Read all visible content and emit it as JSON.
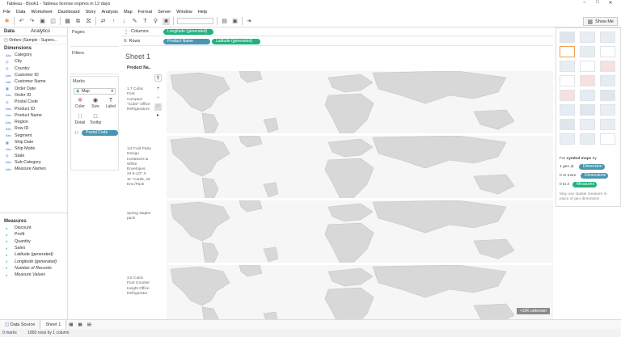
{
  "window": {
    "title": "Tableau - Book1 - Tableau license expires in 12 days"
  },
  "menu": [
    "File",
    "Data",
    "Worksheet",
    "Dashboard",
    "Story",
    "Analysis",
    "Map",
    "Format",
    "Server",
    "Window",
    "Help"
  ],
  "toolbar": {
    "show_me_label": "Show Me"
  },
  "left": {
    "tabs": [
      "Data",
      "Analytics"
    ],
    "datasource": "Orders (Sample - Supers...",
    "dimensions_header": "Dimensions",
    "dimensions": [
      {
        "name": "Category",
        "type": "Abc"
      },
      {
        "name": "City",
        "type": "geo"
      },
      {
        "name": "Country",
        "type": "geo"
      },
      {
        "name": "Customer ID",
        "type": "Abc"
      },
      {
        "name": "Customer Name",
        "type": "Abc"
      },
      {
        "name": "Order Date",
        "type": "date"
      },
      {
        "name": "Order ID",
        "type": "Abc"
      },
      {
        "name": "Postal Code",
        "type": "geo"
      },
      {
        "name": "Product ID",
        "type": "Abc"
      },
      {
        "name": "Product Name",
        "type": "Abc"
      },
      {
        "name": "Region",
        "type": "Abc"
      },
      {
        "name": "Row ID",
        "type": "Abc"
      },
      {
        "name": "Segment",
        "type": "Abc"
      },
      {
        "name": "Ship Date",
        "type": "date"
      },
      {
        "name": "Ship Mode",
        "type": "Abc"
      },
      {
        "name": "State",
        "type": "geo"
      },
      {
        "name": "Sub-Category",
        "type": "Abc"
      },
      {
        "name": "Measure Names",
        "type": "Abc",
        "italic": true
      }
    ],
    "measures_header": "Measures",
    "measures": [
      {
        "name": "Discount"
      },
      {
        "name": "Profit"
      },
      {
        "name": "Quantity"
      },
      {
        "name": "Sales"
      },
      {
        "name": "Latitude (generated)",
        "italic": true
      },
      {
        "name": "Longitude (generated)",
        "italic": true
      },
      {
        "name": "Number of Records",
        "italic": true
      },
      {
        "name": "Measure Values",
        "italic": true
      }
    ]
  },
  "cards": {
    "pages": "Pages",
    "filters": "Filters",
    "marks": "Marks",
    "mark_type": "Map",
    "buttons": [
      "Color",
      "Size",
      "Label",
      "Detail",
      "Tooltip"
    ],
    "postal_pill": "Postal Code"
  },
  "shelves": {
    "columns_label": "Columns",
    "rows_label": "Rows",
    "columns_pill": "Longitude (generated)",
    "rows_pills": [
      "Product Name",
      "Latitude (generated)"
    ]
  },
  "view": {
    "sheet_title": "Sheet 1",
    "column_header": "Product Na..",
    "rows": [
      "1.7 Cubic Foot Compact \"Cube\" Office Refrigerators",
      "1/4 Fold Party Design Invitations & White Envelopes, 24 8-1/2\" X 11\" Cards, 25 Env./Pack",
      "Spring stapler pack",
      "3.6 Cubic Foot Counter Height Office Refrigerator"
    ],
    "unknown_badge": "+10K unknown"
  },
  "showme": {
    "for_label": "For",
    "for_bold": "symbol maps",
    "for_tail": "try",
    "line1_prefix": "1 geo",
    "line1_pill": "Dimension",
    "line2_prefix": "0 or more",
    "line2_pill": "Dimensions",
    "line3_prefix": "0 to 2",
    "line3_pill": "Measures",
    "note": "May use spatial measure in place of geo dimension"
  },
  "bottom": {
    "tabs": [
      "Data Source",
      "Sheet 1"
    ]
  },
  "status": {
    "left": "0 marks",
    "rows": "1850 rows by 1 column"
  }
}
